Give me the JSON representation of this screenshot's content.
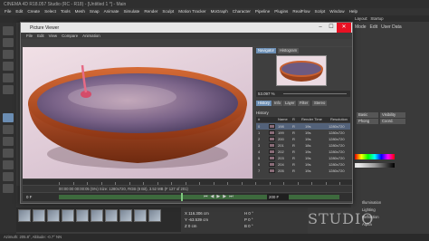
{
  "app": {
    "title": "CINEMA 4D R18.057 Studio (RC - R18) - [Untitled 1 *] - Main",
    "menu": [
      "File",
      "Edit",
      "Create",
      "Select",
      "Tools",
      "Mesh",
      "Snap",
      "Animate",
      "Simulate",
      "Render",
      "Sculpt",
      "Motion Tracker",
      "MoGraph",
      "Character",
      "Pipeline",
      "Plugins",
      "RealFlow",
      "Script",
      "Window",
      "Help"
    ],
    "layout_label": "Layout:",
    "layout_value": "Startup"
  },
  "right_panel": {
    "tabs": [
      "Mode",
      "Edit",
      "User Data"
    ],
    "buttons": [
      "Basic",
      "Visibility",
      "Phong",
      "Coord."
    ],
    "fields": [
      "Illumination",
      "Lighting",
      "Reflection",
      "Alpha"
    ]
  },
  "watermark": "STUDIO",
  "picture_viewer": {
    "title": "Picture Viewer",
    "menu": [
      "File",
      "Edit",
      "View",
      "Compare",
      "Animation"
    ],
    "nav_tabs": [
      "Navigator",
      "Histogram"
    ],
    "zoom": "53.097 %",
    "history_tabs": [
      "History",
      "Info",
      "Layer",
      "Filter",
      "Stereo"
    ],
    "history_label": "History",
    "history_columns": [
      "#",
      "Name",
      "R",
      "Render Time",
      "Resolution"
    ],
    "history_rows": [
      {
        "num": "0",
        "name": "198",
        "r": "R",
        "time": "19s",
        "res": "1280x720"
      },
      {
        "num": "1",
        "name": "199",
        "r": "R",
        "time": "19s",
        "res": "1280x720"
      },
      {
        "num": "2",
        "name": "200",
        "r": "R",
        "time": "19s",
        "res": "1280x720"
      },
      {
        "num": "3",
        "name": "201",
        "r": "R",
        "time": "18s",
        "res": "1280x720"
      },
      {
        "num": "4",
        "name": "202",
        "r": "R",
        "time": "19s",
        "res": "1280x720"
      },
      {
        "num": "5",
        "name": "203",
        "r": "R",
        "time": "19s",
        "res": "1280x720"
      },
      {
        "num": "6",
        "name": "204",
        "r": "R",
        "time": "19s",
        "res": "1280x720"
      },
      {
        "num": "7",
        "name": "205",
        "r": "R",
        "time": "19s",
        "res": "1280x720"
      }
    ],
    "info_line": "00:00:00 00:00:05 (5%)   Size: 1280x720, RGB (8 Bit), 3.52 MB  (F 127 of 201)",
    "frame_current": "0 F",
    "frame_end": "200 F"
  },
  "coords": {
    "x": "116.306 cm",
    "y": "-63.539 cm",
    "z": "0 cm",
    "h": "0 °",
    "p": "0 °",
    "b": "0 °"
  },
  "status": "Azimuth: 205.8°, Altitude: -0.7° NN"
}
